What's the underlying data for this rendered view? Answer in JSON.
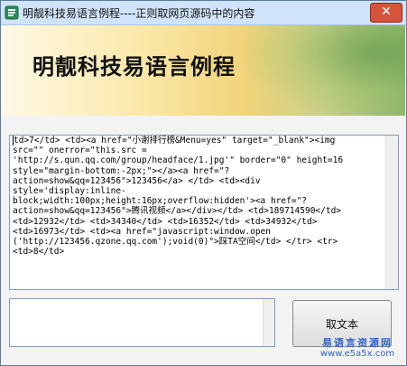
{
  "window": {
    "title": "明靓科技易语言例程----正则取网页源码中的内容",
    "close_glyph": "✕"
  },
  "banner": {
    "title": "明靓科技易语言例程"
  },
  "source_box": {
    "lines": [
      "td>7</td> <td><a href=\"小谢排行榜&Menu=yes\" target=\"_blank\"><img",
      "src=\"\" onerror=\"this.src =",
      "'http://s.qun.qq.com/group/headface/1.jpg'\" border=\"0\" height=16",
      "style=\"margin-bottom:-2px;\"></a><a href=\"?",
      "action=show&qq=123456\">123456</a> </td> <td><div",
      "style='display:inline-",
      "block;width:100px;height:16px;overflow:hidden'><a href=\"?",
      "action=show&qq=123456\">腾讯视频</a></div></td> <td>189714590</td>",
      "<td>12932</td> <td>34340</td> <td>16352</td> <td>34932</td>",
      "<td>16973</td> <td><a href=\"javascript:window.open",
      "('http://123456.qzone.qq.com');void(0)\">踩TA空间</td> </tr> <tr>",
      "<td>8</td>"
    ]
  },
  "output_box": {
    "value": ""
  },
  "fetch_button": {
    "label": "取文本"
  },
  "watermark": {
    "name": "易语言资源网",
    "url": "www.e5a5x.com"
  }
}
